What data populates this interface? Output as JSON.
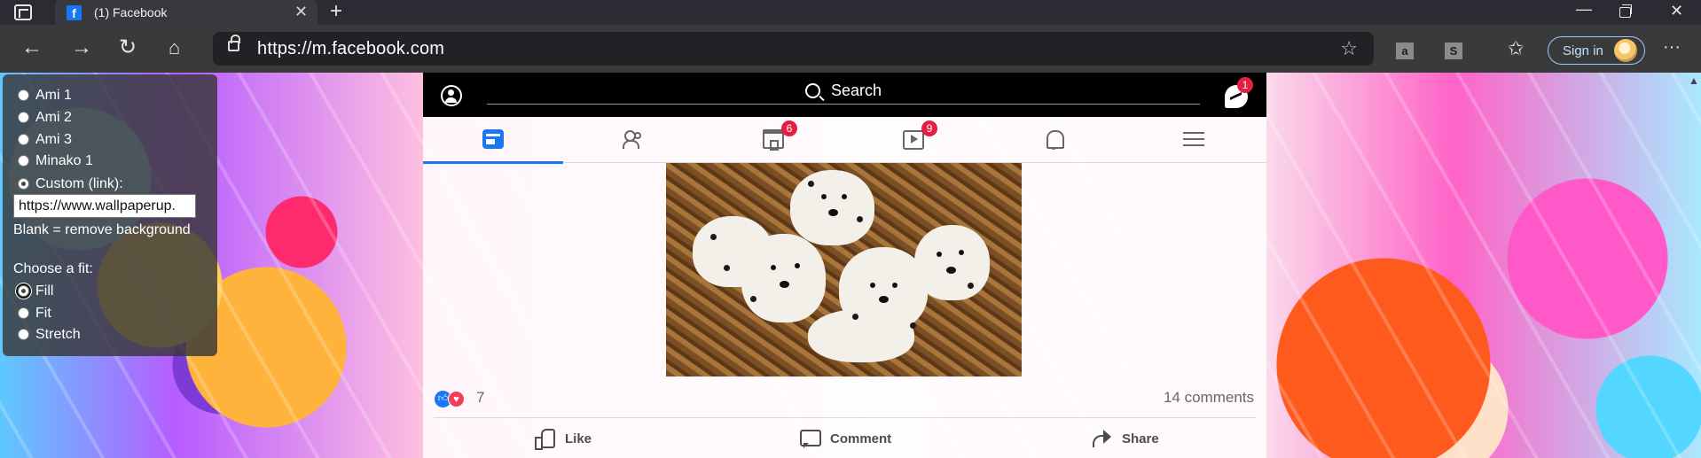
{
  "browser": {
    "tab": {
      "title": "(1) Facebook",
      "favicon": "f"
    },
    "new_tab": "+",
    "url": "https://m.facebook.com",
    "extensions": [
      "a",
      "S"
    ],
    "signin_label": "Sign in",
    "more": "···",
    "window": {
      "minimize": "—",
      "close": "✕"
    }
  },
  "settings": {
    "backgrounds": [
      "Ami 1",
      "Ami 2",
      "Ami 3",
      "Minako 1",
      "Custom (link):"
    ],
    "custom_link_value": "https://www.wallpaperup.",
    "blank_hint": "Blank = remove background",
    "fit_heading": "Choose a fit:",
    "fits": [
      "Fill",
      "Fit",
      "Stretch"
    ],
    "selected_fit": "Fill"
  },
  "facebook": {
    "search_label": "Search",
    "messenger_badge": "1",
    "tabs": [
      {
        "name": "news-feed",
        "badge": ""
      },
      {
        "name": "friends",
        "badge": ""
      },
      {
        "name": "marketplace",
        "badge": "6"
      },
      {
        "name": "watch",
        "badge": "9"
      },
      {
        "name": "notifications",
        "badge": ""
      },
      {
        "name": "menu",
        "badge": ""
      }
    ],
    "post": {
      "reaction_count": "7",
      "comments": "14 comments",
      "actions": {
        "like": "Like",
        "comment": "Comment",
        "share": "Share"
      }
    }
  },
  "colors": {
    "fb_blue": "#1877f2",
    "badge_red": "#e41e3f",
    "tabstrip": "#2b2b33",
    "toolbar": "#3a3a3a"
  }
}
